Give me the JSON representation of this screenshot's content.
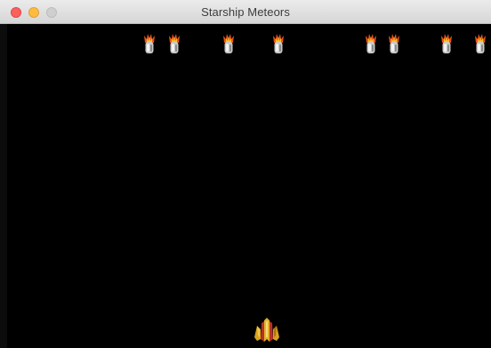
{
  "window": {
    "title": "Starship Meteors",
    "controls": [
      "close-icon",
      "minimize-icon",
      "zoom-icon"
    ]
  },
  "game": {
    "meteor_count": 8,
    "sprites": {
      "meteor": "flaming-meteor-icon",
      "player": "starship-icon"
    },
    "colors": {
      "background": "#000000",
      "flame_outer": "#e8561c",
      "flame_inner": "#ffc21f",
      "meteor_body": "#c9c9c9",
      "ship_gold": "#d9a21a",
      "ship_red": "#b5322a"
    }
  }
}
